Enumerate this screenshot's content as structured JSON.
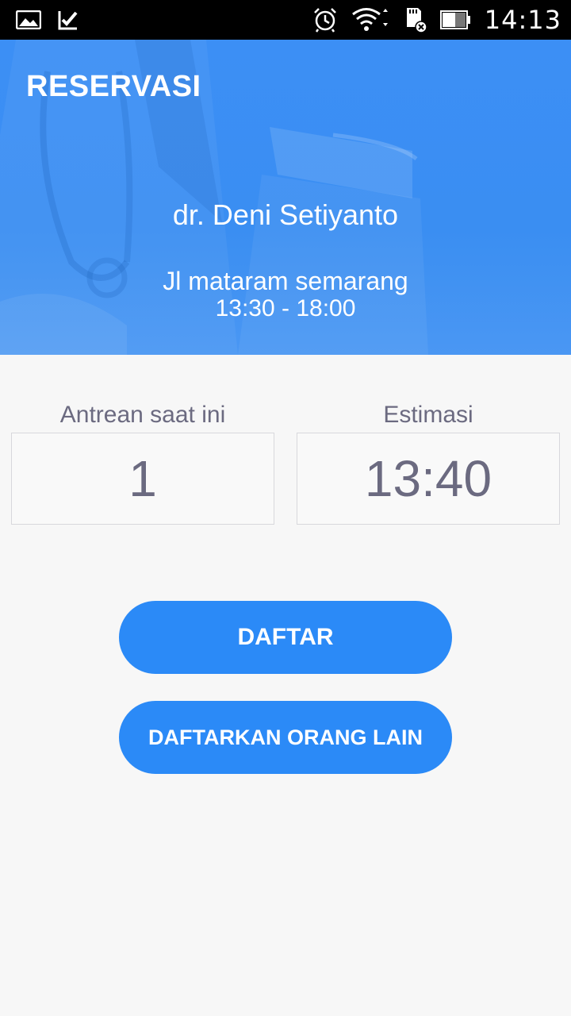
{
  "status_bar": {
    "time": "14:13",
    "icons": [
      "gallery-icon",
      "checklist-icon",
      "alarm-icon",
      "wifi-icon",
      "sd-card-icon",
      "battery-icon"
    ]
  },
  "header": {
    "title": "RESERVASI",
    "doctor_name": "dr. Deni Setiyanto",
    "address": "Jl mataram semarang",
    "hours": "13:30 - 18:00"
  },
  "queue": {
    "current_label": "Antrean saat ini",
    "current_value": "1",
    "estimate_label": "Estimasi",
    "estimate_value": "13:40"
  },
  "actions": {
    "register_label": "DAFTAR",
    "register_other_label": "DAFTARKAN ORANG LAIN"
  },
  "colors": {
    "accent": "#2b8af7",
    "header": "#3c8ff5",
    "text_muted": "#6b6a80"
  }
}
